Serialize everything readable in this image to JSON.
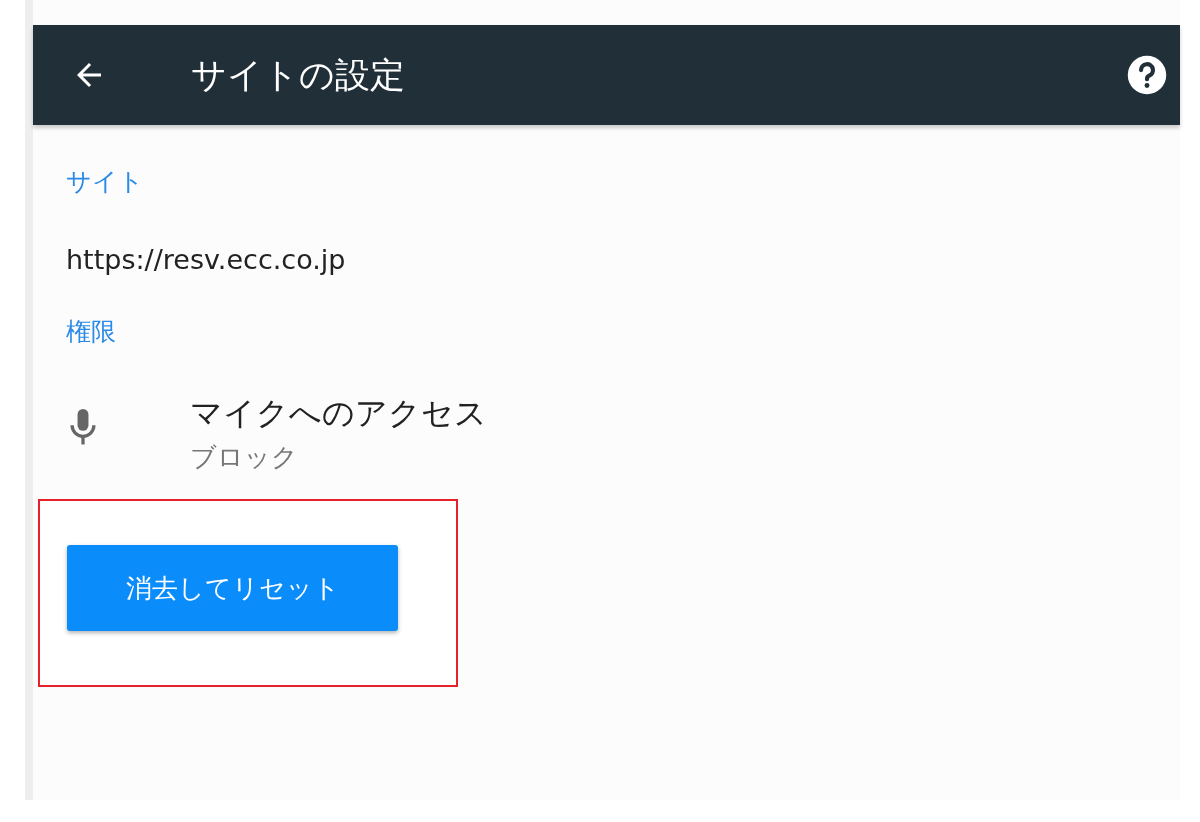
{
  "toolbar": {
    "title": "サイトの設定"
  },
  "sections": [
    {
      "heading": "サイト",
      "text": "https://resv.ecc.co.jp"
    },
    {
      "heading": "権限",
      "permissions": [
        {
          "kind": "microphone",
          "title": "マイクへのアクセス",
          "status": "ブロック"
        }
      ]
    }
  ],
  "reset_button": {
    "label": "消去してリセット"
  }
}
